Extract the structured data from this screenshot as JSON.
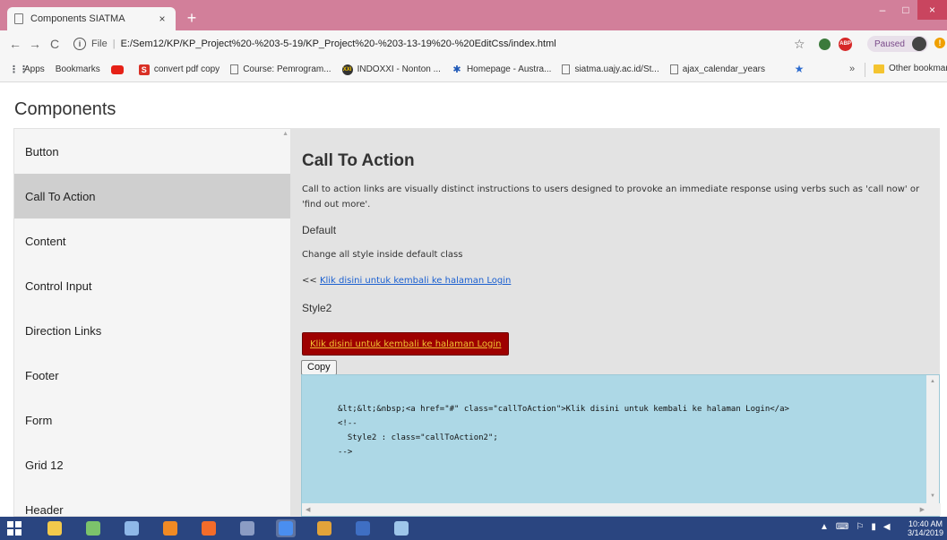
{
  "browser": {
    "tab_title": "Components SIATMA",
    "tab_close": "×",
    "new_tab": "+",
    "window_controls": {
      "minimize": "–",
      "maximize": "□",
      "close": "×"
    },
    "url_scheme": "File",
    "url_separator": "|",
    "url": "E:/Sem12/KP/KP_Project%20-%203-5-19/KP_Project%20-%203-13-19%20-%20EditCss/index.html",
    "nav": {
      "back": "←",
      "forward": "→",
      "reload": "C"
    },
    "star": "☆",
    "abp_label": "ABP",
    "paused_label": "Paused",
    "alert": "!"
  },
  "bookmarks": {
    "items": [
      {
        "label": "Apps",
        "icon": "apps-grid-icon",
        "glyph": "⋮⋮"
      },
      {
        "label": "Bookmarks",
        "icon": "star-icon",
        "glyph": "★"
      },
      {
        "label": "",
        "icon": "youtube-icon",
        "glyph": ""
      },
      {
        "label": "convert pdf copy",
        "icon": "s-icon",
        "glyph": "S"
      },
      {
        "label": "Course: Pemrogram...",
        "icon": "doc-icon",
        "glyph": ""
      },
      {
        "label": "INDOXXI - Nonton ...",
        "icon": "indoxxi-icon",
        "glyph": "XXI"
      },
      {
        "label": "Homepage - Austra...",
        "icon": "homepage-icon",
        "glyph": "✱"
      },
      {
        "label": "siatma.uajy.ac.id/St...",
        "icon": "doc-icon",
        "glyph": ""
      },
      {
        "label": "ajax_calendar_years",
        "icon": "doc-icon",
        "glyph": ""
      }
    ],
    "more": "»",
    "other": "Other bookmarks"
  },
  "page": {
    "heading": "Components",
    "sidebar": [
      {
        "label": "Button"
      },
      {
        "label": "Call To Action",
        "active": true
      },
      {
        "label": "Content"
      },
      {
        "label": "Control Input"
      },
      {
        "label": "Direction Links"
      },
      {
        "label": "Footer"
      },
      {
        "label": "Form"
      },
      {
        "label": "Grid 12"
      },
      {
        "label": "Header"
      }
    ],
    "content": {
      "title": "Call To Action",
      "description": "Call to action links are visually distinct instructions to users designed to provoke an immediate response using verbs such as 'call now' or 'find out more'.",
      "default_label": "Default",
      "change_text": "Change all style inside default class",
      "link_prefix": "<< ",
      "link_text": "Klik disini untuk kembali ke halaman Login",
      "style2_label": "Style2",
      "style2_button": "Klik disini untuk kembali ke halaman Login",
      "copy_button": "Copy",
      "code_lines": [
        "&lt;&lt;&nbsp;<a href=\"#\" class=\"callToAction\">Klik disini untuk kembali ke halaman Login</a>",
        "<!--",
        "  Style2 : class=\"callToAction2\";",
        "-->"
      ]
    }
  },
  "taskbar": {
    "apps": [
      {
        "name": "file-explorer-icon",
        "color": "#f2c94c"
      },
      {
        "name": "android-studio-icon",
        "color": "#7cc36b"
      },
      {
        "name": "network-icon",
        "color": "#8fb8e8"
      },
      {
        "name": "sublime-text-icon",
        "color": "#f08a24"
      },
      {
        "name": "xampp-icon",
        "color": "#f36c2a"
      },
      {
        "name": "sql-icon",
        "color": "#8b9cc4"
      },
      {
        "name": "chrome-icon",
        "color": "#4a8ef0",
        "active": true
      },
      {
        "name": "sketchup-icon",
        "color": "#e2a33a"
      },
      {
        "name": "word-icon",
        "color": "#3f6fc4"
      },
      {
        "name": "paint-icon",
        "color": "#9ec6ea"
      }
    ],
    "tray_caret": "▲",
    "time": "10:40 AM",
    "date": "3/14/2019"
  },
  "colors": {
    "tab_strip": "#d27f9a",
    "active_sidebar": "#cfcfcf",
    "cta2_background": "#9e0000",
    "cta2_text": "#f1c232",
    "code_background": "#add8e6",
    "taskbar": "#2a4580"
  }
}
